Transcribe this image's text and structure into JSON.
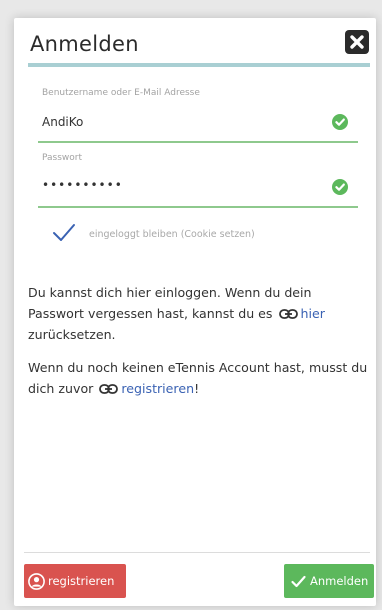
{
  "dialog": {
    "title": "Anmelden",
    "close_icon": "close-icon"
  },
  "form": {
    "username": {
      "label": "Benutzername oder E-Mail Adresse",
      "value": "AndiKo",
      "valid_icon": "check-circle-icon"
    },
    "password": {
      "label": "Passwort",
      "value": "••••••••••",
      "valid_icon": "check-circle-icon"
    },
    "remember": {
      "label": "eingeloggt bleiben (Cookie setzen)",
      "checked": true
    }
  },
  "info": {
    "p1_text": "Du kannst dich hier einloggen. Wenn du dein Passwort vergessen hast, kannst du es",
    "p1_link": "hier",
    "p1_after": "zurücksetzen.",
    "p2_text": "Wenn du noch keinen eTennis Account hast, musst du dich zuvor",
    "p2_link": "registrieren",
    "p2_after": "!"
  },
  "footer": {
    "register_label": "registrieren",
    "login_label": "Anmelden"
  },
  "colors": {
    "accent_rule": "#a9cfd3",
    "valid_green": "#5cb85c",
    "register_red": "#d9534f",
    "link_blue": "#3a62b3"
  }
}
